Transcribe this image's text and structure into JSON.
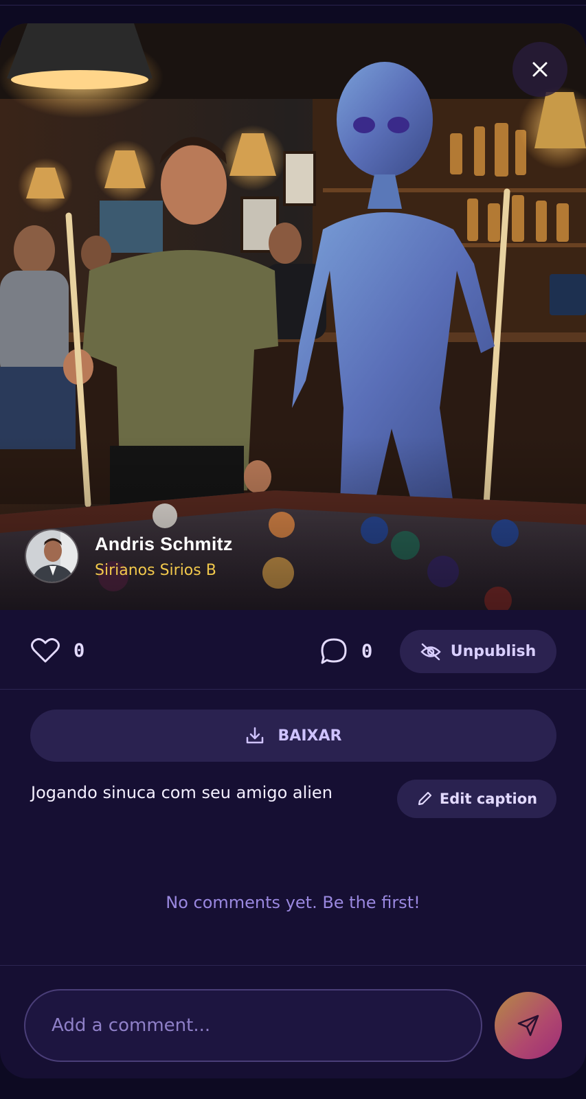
{
  "post": {
    "author_name": "Andris Schmitz",
    "author_subtitle": "Sirianos Sirios B",
    "likes": "0",
    "comments": "0",
    "unpublish_label": "Unpublish",
    "download_label": "BAIXAR",
    "caption": "Jogando sinuca com seu amigo alien",
    "edit_caption_label": "Edit caption"
  },
  "comments_section": {
    "empty_text": "No comments yet. Be the first!",
    "input_placeholder": "Add a comment..."
  },
  "icons": {
    "close": "close-icon",
    "like": "heart-icon",
    "comment": "comment-bubble-icon",
    "unpublish": "eye-off-icon",
    "download": "download-icon",
    "edit": "pencil-icon",
    "send": "send-icon"
  },
  "colors": {
    "background": "#160f33",
    "accent_text": "#f2c94c",
    "button_bg": "#2a2250",
    "muted_text": "#9a88e0"
  }
}
